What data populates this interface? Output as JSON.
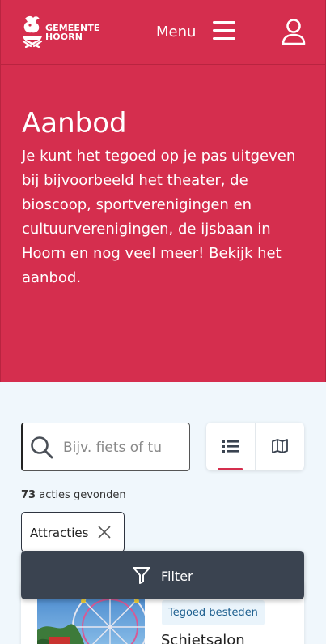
{
  "header": {
    "logo_line1": "GEMEENTE",
    "logo_line2": "HOORN",
    "menu_label": "Menu",
    "icons": [
      "hoorn-logo-icon",
      "hamburger-icon",
      "user-icon"
    ]
  },
  "hero": {
    "title": "Aanbod",
    "description": "Je kunt het tegoed op je pas uitgeven bij bijvoorbeeld het theater, de bioscoop, sportverenigingen en cultuurverenigingen, de ijsbaan in Hoorn en nog veel meer! Bekijk het aanbod."
  },
  "search": {
    "placeholder": "Bijv. fiets of tu",
    "value": ""
  },
  "view_toggle": {
    "active": "list",
    "options": [
      "list-view-icon",
      "map-view-icon"
    ]
  },
  "results": {
    "count": "73",
    "label": "acties gevonden"
  },
  "active_filter": {
    "label": "Attracties"
  },
  "filter_button": {
    "label": "Filter"
  },
  "card": {
    "badge": "Tegoed besteden",
    "title": "Schietsalon"
  },
  "colors": {
    "brand": "#d52e4e",
    "dark": "#3a4350",
    "page_bg": "#f0f7fc",
    "badge_text": "#1d5f8f"
  }
}
